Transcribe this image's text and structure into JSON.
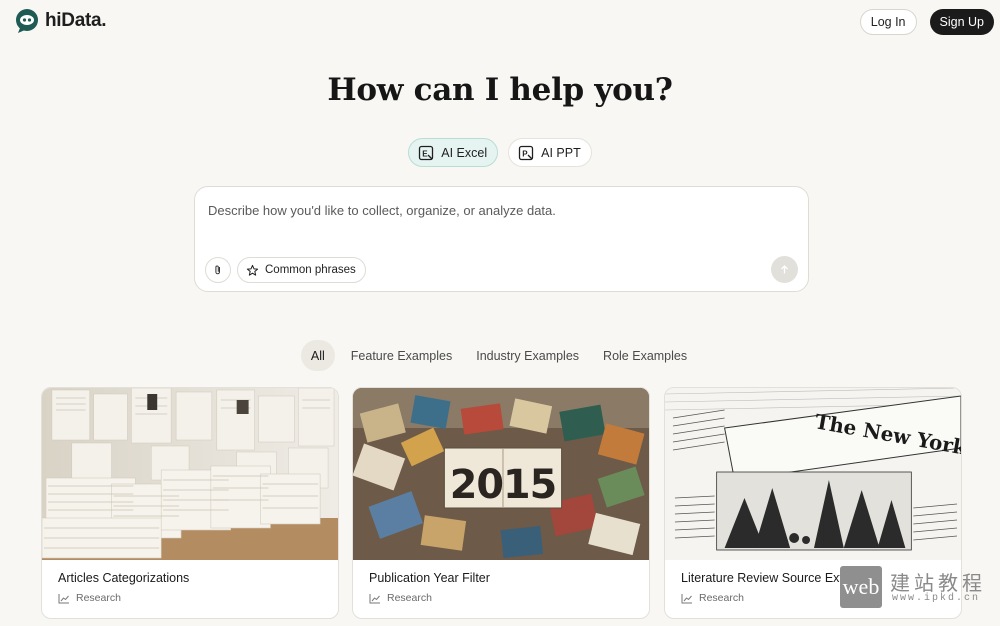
{
  "header": {
    "brand": "hiData.",
    "login_label": "Log In",
    "signup_label": "Sign Up"
  },
  "hero": {
    "title": "How can I help you?"
  },
  "modes": [
    {
      "label": "AI Excel",
      "icon": "excel-icon",
      "active": true
    },
    {
      "label": "AI PPT",
      "icon": "ppt-icon",
      "active": false
    }
  ],
  "prompt": {
    "placeholder": "Describe how you'd like to collect, organize, or analyze data.",
    "common_phrases_label": "Common phrases"
  },
  "tabs": [
    {
      "label": "All",
      "active": true
    },
    {
      "label": "Feature Examples",
      "active": false
    },
    {
      "label": "Industry Examples",
      "active": false
    },
    {
      "label": "Role Examples",
      "active": false
    }
  ],
  "cards": [
    {
      "title": "Articles Categorizations",
      "category": "Research",
      "image": "stacked-papers-image"
    },
    {
      "title": "Publication Year Filter",
      "category": "Research",
      "image": "books-2015-image"
    },
    {
      "title": "Literature Review Source Extractor",
      "category": "Research",
      "image": "newspaper-image"
    }
  ],
  "watermark": {
    "badge": "web",
    "chinese": "建站教程",
    "url": "www.ipkd.cn"
  },
  "colors": {
    "background": "#f8f7f3",
    "accent": "#1e5b55",
    "active_mode_bg": "#e6f4f1"
  }
}
